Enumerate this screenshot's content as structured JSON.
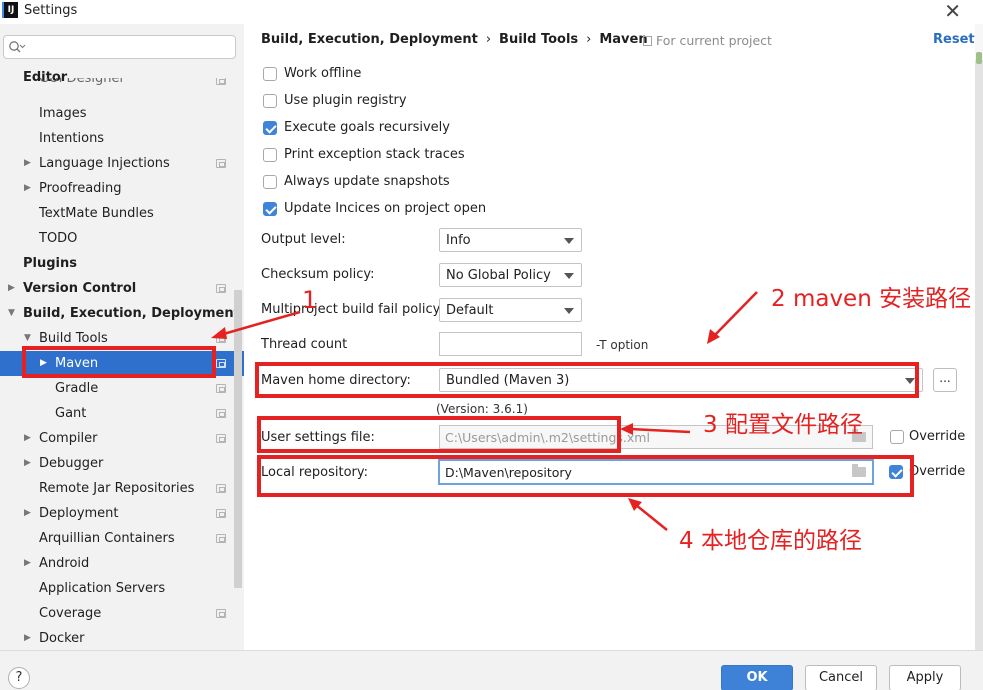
{
  "window": {
    "title": "Settings",
    "app_icon_text": "IJ"
  },
  "sidebar": {
    "search_placeholder": "",
    "items": [
      {
        "label": "Editor",
        "bold": true
      },
      {
        "label": "GUI Designer"
      },
      {
        "label": "Images"
      },
      {
        "label": "Intentions"
      },
      {
        "label": "Language Injections"
      },
      {
        "label": "Proofreading"
      },
      {
        "label": "TextMate Bundles"
      },
      {
        "label": "TODO"
      },
      {
        "label": "Plugins",
        "bold": true
      },
      {
        "label": "Version Control",
        "bold": true
      },
      {
        "label": "Build, Execution, Deployment",
        "bold": true
      },
      {
        "label": "Build Tools"
      },
      {
        "label": "Maven",
        "selected": true
      },
      {
        "label": "Gradle"
      },
      {
        "label": "Gant"
      },
      {
        "label": "Compiler"
      },
      {
        "label": "Debugger"
      },
      {
        "label": "Remote Jar Repositories"
      },
      {
        "label": "Deployment"
      },
      {
        "label": "Arquillian Containers"
      },
      {
        "label": "Android"
      },
      {
        "label": "Application Servers"
      },
      {
        "label": "Coverage"
      },
      {
        "label": "Docker"
      }
    ]
  },
  "header": {
    "breadcrumbs": [
      "Build, Execution, Deployment",
      "Build Tools",
      "Maven"
    ],
    "separator": "›",
    "scope": "For current project",
    "reset_label": "Reset"
  },
  "options": [
    {
      "label": "Work offline",
      "checked": false
    },
    {
      "label": "Use plugin registry",
      "checked": false
    },
    {
      "label": "Execute goals recursively",
      "checked": true
    },
    {
      "label": "Print exception stack traces",
      "checked": false
    },
    {
      "label": "Always update snapshots",
      "checked": false
    },
    {
      "label": "Update Incices on project open",
      "checked": true
    }
  ],
  "fields": {
    "output_level": {
      "label": "Output level:",
      "value": "Info"
    },
    "checksum_policy": {
      "label": "Checksum policy:",
      "value": "No Global Policy"
    },
    "multiproject_policy": {
      "label": "Multiproject build fail policy:",
      "value": "Default"
    },
    "thread_count": {
      "label": "Thread count",
      "value": "",
      "hint": "-T option"
    },
    "maven_home": {
      "label": "Maven home directory:",
      "value": "Bundled (Maven 3)",
      "version": "(Version: 3.6.1)",
      "browse_label": "..."
    },
    "user_settings": {
      "label": "User settings file:",
      "value": "C:\\Users\\admin\\.m2\\settings.xml",
      "override_label": "Override",
      "override_checked": false
    },
    "local_repo": {
      "label": "Local repository:",
      "value": "D:\\Maven\\repository",
      "override_label": "Override",
      "override_checked": true
    }
  },
  "annotations": {
    "a1": "1",
    "a2": "2 maven 安装路径",
    "a3": "3   配置文件路径",
    "a4": "4 本地仓库的路径",
    "color": "#e52222"
  },
  "buttons": {
    "help": "?",
    "ok": "OK",
    "cancel": "Cancel",
    "apply": "Apply"
  },
  "colors": {
    "accent": "#2e70cc",
    "link": "#2a6ebe",
    "annotation": "#e52222"
  }
}
